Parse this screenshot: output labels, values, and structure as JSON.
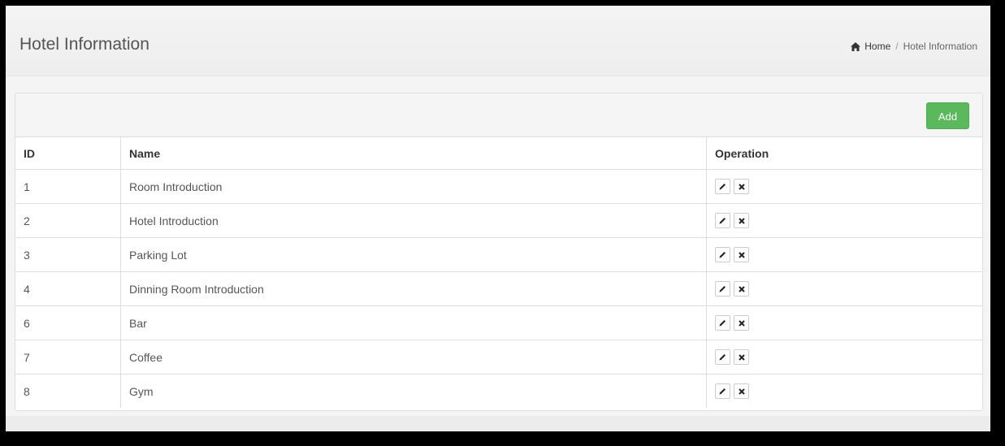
{
  "header": {
    "title": "Hotel Information",
    "breadcrumb": {
      "home": "Home",
      "separator": "/",
      "current": "Hotel Information"
    }
  },
  "toolbar": {
    "add_label": "Add"
  },
  "table": {
    "columns": [
      "ID",
      "Name",
      "Operation"
    ],
    "rows": [
      {
        "id": "1",
        "name": "Room Introduction"
      },
      {
        "id": "2",
        "name": "Hotel Introduction"
      },
      {
        "id": "3",
        "name": "Parking Lot"
      },
      {
        "id": "4",
        "name": "Dinning Room Introduction"
      },
      {
        "id": "6",
        "name": "Bar"
      },
      {
        "id": "7",
        "name": "Coffee"
      },
      {
        "id": "8",
        "name": "Gym"
      }
    ],
    "row_actions": [
      "edit-icon",
      "delete-icon"
    ]
  },
  "colors": {
    "add_button": "#5cb85c",
    "background": "#f4f4f4"
  }
}
